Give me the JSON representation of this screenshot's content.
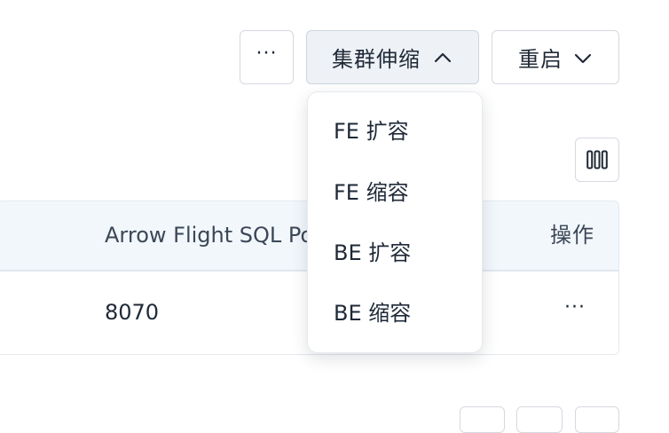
{
  "toolbar": {
    "more_label": "···",
    "scale_label": "集群伸缩",
    "restart_label": "重启"
  },
  "scale_menu": {
    "items": [
      {
        "label": "FE 扩容"
      },
      {
        "label": "FE 缩容"
      },
      {
        "label": "BE 扩容"
      },
      {
        "label": "BE 缩容"
      }
    ]
  },
  "table": {
    "headers": {
      "port": "Arrow Flight SQL Port",
      "actions": "操作"
    },
    "rows": [
      {
        "port": "8070",
        "actions": "···"
      }
    ]
  },
  "icons": {
    "scale_chevron": "chevron-up-icon",
    "restart_chevron": "chevron-down-icon",
    "columns": "columns-icon"
  },
  "colors": {
    "header_bg": "#f2f7fb",
    "active_button_bg": "#eef2f6",
    "text": "#1f2937"
  }
}
